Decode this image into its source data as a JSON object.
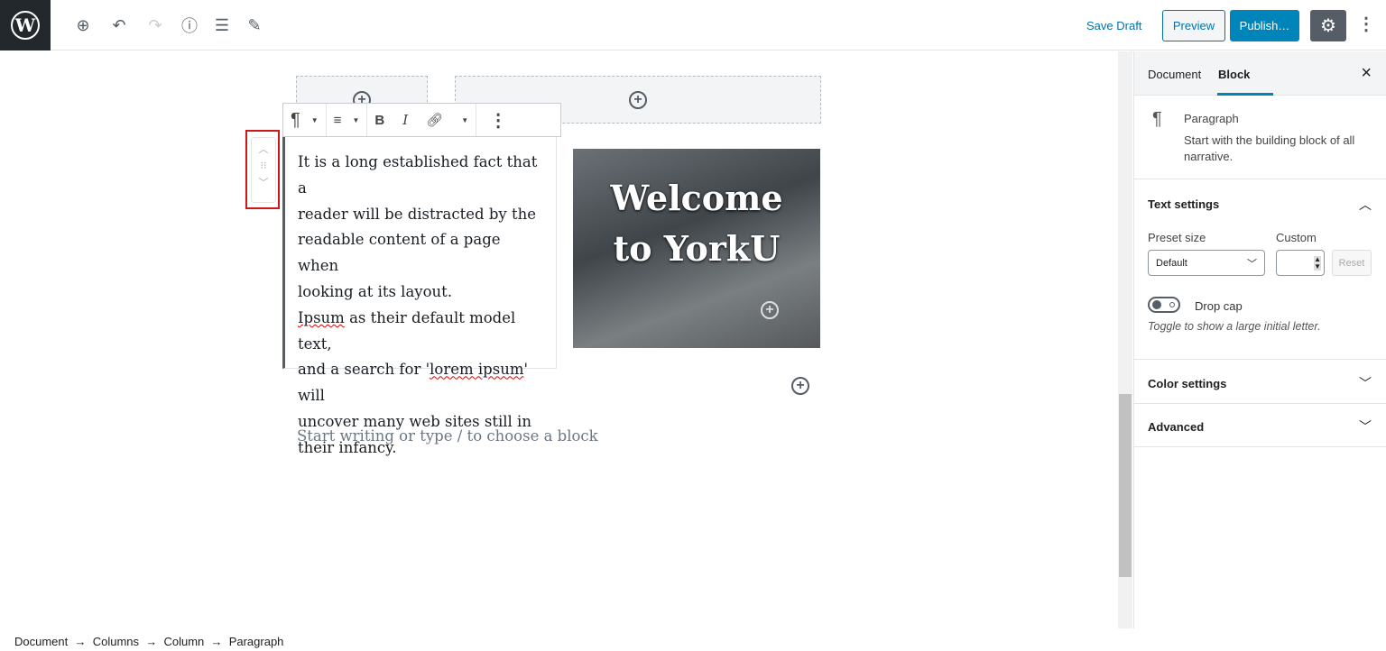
{
  "header": {
    "logo": "W",
    "icons": [
      "add-block-icon",
      "undo-icon",
      "redo-icon",
      "info-icon",
      "outline-icon",
      "edit-icon"
    ],
    "save_draft": "Save Draft",
    "preview": "Preview",
    "publish": "Publish…"
  },
  "toolbar": {
    "paragraph_icon": "¶",
    "bold": "B",
    "italic": "I"
  },
  "paragraph": {
    "lines": [
      "It is a long established fact that a",
      "reader will be distracted by the",
      "readable content of a page when",
      "looking at its layout."
    ],
    "line5a": "Ipsum",
    "line5b": " as their default model text,",
    "line6a": "and a search for '",
    "line6b": "lorem ipsum",
    "line6c": "' will",
    "line7": "uncover many web sites still in",
    "line8": "their infancy."
  },
  "image": {
    "line1": "Welcome",
    "line2": "to YorkU"
  },
  "placeholder": "Start writing or type / to choose a block",
  "sidebar": {
    "tabs": [
      "Document",
      "Block"
    ],
    "active_tab": "Block",
    "close": "×",
    "block_icon": "¶",
    "block_name": "Paragraph",
    "block_desc": "Start with the building block of all narrative.",
    "text_settings": "Text settings",
    "preset_label": "Preset size",
    "preset_value": "Default",
    "custom_label": "Custom",
    "reset": "Reset",
    "drop_cap": "Drop cap",
    "drop_cap_on": false,
    "drop_cap_help": "Toggle to show a large initial letter.",
    "color_settings": "Color settings",
    "advanced": "Advanced"
  },
  "breadcrumb": [
    "Document",
    "Columns",
    "Column",
    "Paragraph"
  ],
  "colors": {
    "accent": "#0085ba",
    "highlight": "#cc1818"
  }
}
